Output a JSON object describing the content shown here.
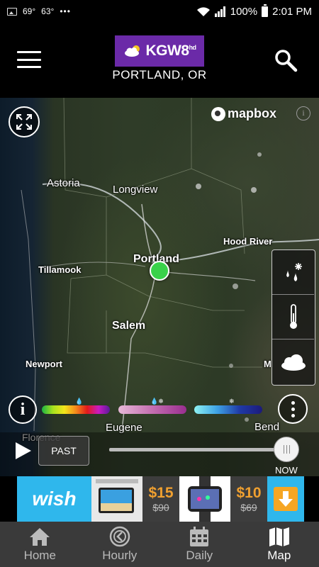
{
  "status_bar": {
    "temp_left": "69°",
    "temp_right": "63°",
    "dots": "•••",
    "battery": "100%",
    "time": "2:01 PM"
  },
  "header": {
    "logo_text": "KGW8",
    "logo_suffix": "hd",
    "city": "PORTLAND, OR"
  },
  "map": {
    "attribution": "mapbox",
    "labels": {
      "astoria": "Astoria",
      "longview": "Longview",
      "hood_river": "Hood River",
      "portland": "Portland",
      "tillamook": "Tillamook",
      "salem": "Salem",
      "newport": "Newport",
      "eugene": "Eugene",
      "bend": "Bend",
      "florence": "Florence",
      "m_partial": "M"
    }
  },
  "timeline": {
    "past_label": "PAST",
    "now_label": "NOW",
    "position": 1.0
  },
  "ad": {
    "brand": "wish",
    "price1": "$15",
    "was1": "$90",
    "price2": "$10",
    "was2": "$69"
  },
  "nav": {
    "home": "Home",
    "hourly": "Hourly",
    "daily": "Daily",
    "map": "Map",
    "active": "map"
  },
  "colors": {
    "brand_purple": "#6b2aa8",
    "location_green": "#39d24a",
    "ad_blue": "#2fb7ec",
    "price_orange": "#f0a030"
  }
}
